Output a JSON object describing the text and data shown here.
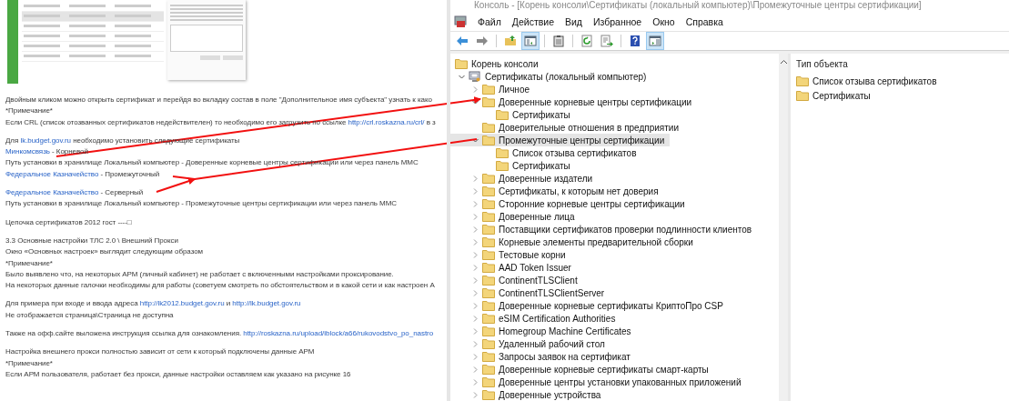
{
  "document": {
    "paragraphs": [
      {
        "lines": [
          [
            {
              "kind": "plain",
              "text": "Двойным кликом можно открыть сертификат и перейдя во вкладку состав в поле \"Дополнительное имя субъекта\" узнать к како"
            }
          ],
          [
            {
              "kind": "plain",
              "text": "*Примечание*"
            }
          ],
          [
            {
              "kind": "plain",
              "text": "Если CRL (список отозванных сертификатов недействителен) то необходимо его загрузить по ссылке "
            },
            {
              "kind": "link",
              "text": "http://crl.roskazna.ru/crl/"
            },
            {
              "kind": "plain",
              "text": " в з"
            }
          ]
        ]
      },
      {
        "lines": [
          [
            {
              "kind": "plain",
              "text": "Для "
            },
            {
              "kind": "link",
              "text": "lk.budget.gov.ru"
            },
            {
              "kind": "plain",
              "text": " необходимо установить следующие сертификаты"
            }
          ],
          [
            {
              "kind": "link",
              "text": "Минкомсвязь"
            },
            {
              "kind": "plain",
              "text": " - Корневой"
            }
          ],
          [
            {
              "kind": "plain",
              "text": "Путь установки в хранилище Локальный компьютер - Доверенные корневые центры сертификации или через панель MMC"
            }
          ],
          [
            {
              "kind": "link",
              "text": "Федеральное Казначейство"
            },
            {
              "kind": "plain",
              "text": " - Промежуточный"
            }
          ]
        ]
      },
      {
        "lines": [
          [
            {
              "kind": "link",
              "text": "Федеральное Казначейство"
            },
            {
              "kind": "plain",
              "text": " - Серверный"
            }
          ],
          [
            {
              "kind": "plain",
              "text": "Путь установки в хранилище Локальный компьютер - Промежуточные центры сертификации или через панель MMC"
            }
          ]
        ]
      },
      {
        "lines": [
          [
            {
              "kind": "plain",
              "text": "Цепочка сертификатов 2012 гост ----□"
            }
          ]
        ]
      },
      {
        "lines": [
          [
            {
              "kind": "plain",
              "text": "3.3 Основные настройки ТЛС 2.0 \\ Внешний Прокси"
            }
          ],
          [
            {
              "kind": "plain",
              "text": "Окно «Основных настроек» выглядит следующим образом"
            }
          ],
          [
            {
              "kind": "plain",
              "text": "*Примечание*"
            }
          ],
          [
            {
              "kind": "plain",
              "text": "Было выявлено что, на некоторых АРМ (личный кабинет) не работает с включенными настройками проксирование."
            }
          ],
          [
            {
              "kind": "plain",
              "text": "На некоторых данные галочки необходимы для работы (советуем смотреть по обстоятельством и в какой сети и как настроен А"
            }
          ]
        ]
      },
      {
        "lines": [
          [
            {
              "kind": "plain",
              "text": "Для примера при входе и ввода адреса "
            },
            {
              "kind": "link",
              "text": "http://lk2012.budget.gov.ru"
            },
            {
              "kind": "plain",
              "text": " и "
            },
            {
              "kind": "link",
              "text": "http://lk.budget.gov.ru"
            }
          ],
          [
            {
              "kind": "plain",
              "text": "Не отображается страница\\Страница не доступна"
            }
          ]
        ]
      },
      {
        "lines": [
          [
            {
              "kind": "plain",
              "text": "Также на офф.сайте выложена инструкция ссылка для ознакомления. "
            },
            {
              "kind": "link",
              "text": "http://roskazna.ru/upload/iblock/a66/rukovodstvo_po_nastro"
            }
          ]
        ]
      },
      {
        "lines": [
          [
            {
              "kind": "plain",
              "text": "Настройка внешнего прокси полностью зависит от сети к который подключены данные АРМ"
            }
          ],
          [
            {
              "kind": "plain",
              "text": "*Примечание*"
            }
          ],
          [
            {
              "kind": "plain",
              "text": "Если АРМ пользователя, работает без прокси, данные настройки оставляем как указано на рисунке 16"
            }
          ]
        ]
      }
    ]
  },
  "console": {
    "title": "Консоль - [Корень консоли\\Сертификаты (локальный компьютер)\\Промежуточные центры сертификации]",
    "menu": [
      "Файл",
      "Действие",
      "Вид",
      "Избранное",
      "Окно",
      "Справка"
    ],
    "toolbar": [
      {
        "kind": "back",
        "pressed": false
      },
      {
        "kind": "forward",
        "pressed": false
      },
      {
        "kind": "separator"
      },
      {
        "kind": "up",
        "pressed": false
      },
      {
        "kind": "tree",
        "pressed": true
      },
      {
        "kind": "separator"
      },
      {
        "kind": "clipboard",
        "pressed": false
      },
      {
        "kind": "separator"
      },
      {
        "kind": "refresh",
        "pressed": false
      },
      {
        "kind": "export",
        "pressed": false
      },
      {
        "kind": "separator"
      },
      {
        "kind": "help",
        "pressed": false
      },
      {
        "kind": "actions",
        "pressed": true
      }
    ],
    "tree": [
      {
        "label": "Корень консоли",
        "kind": "folder",
        "selected": false,
        "children": [
          {
            "label": "Сертификаты (локальный компьютер)",
            "kind": "store",
            "selected": false,
            "expanded": true,
            "children": [
              {
                "label": "Личное",
                "kind": "folder",
                "selected": false,
                "expanded": false
              },
              {
                "label": "Доверенные корневые центры сертификации",
                "kind": "folder",
                "selected": false,
                "expanded": true,
                "children": [
                  {
                    "label": "Сертификаты",
                    "kind": "folder",
                    "selected": false
                  }
                ]
              },
              {
                "label": "Доверительные отношения в предприятии",
                "kind": "folder",
                "selected": false
              },
              {
                "label": "Промежуточные центры сертификации",
                "kind": "folder",
                "selected": true,
                "expanded": true,
                "children": [
                  {
                    "label": "Список отзыва сертификатов",
                    "kind": "folder",
                    "selected": false
                  },
                  {
                    "label": "Сертификаты",
                    "kind": "folder",
                    "selected": false
                  }
                ]
              },
              {
                "label": "Доверенные издатели",
                "kind": "folder",
                "selected": false,
                "expanded": false
              },
              {
                "label": "Сертификаты, к которым нет доверия",
                "kind": "folder",
                "selected": false,
                "expanded": false
              },
              {
                "label": "Сторонние корневые центры сертификации",
                "kind": "folder",
                "selected": false,
                "expanded": false
              },
              {
                "label": "Доверенные лица",
                "kind": "folder",
                "selected": false,
                "expanded": false
              },
              {
                "label": "Поставщики сертификатов проверки подлинности клиентов",
                "kind": "folder",
                "selected": false,
                "expanded": false
              },
              {
                "label": "Корневые элементы предварительной сборки",
                "kind": "folder",
                "selected": false,
                "expanded": false
              },
              {
                "label": "Тестовые корни",
                "kind": "folder",
                "selected": false,
                "expanded": false
              },
              {
                "label": "AAD Token Issuer",
                "kind": "folder",
                "selected": false,
                "expanded": false
              },
              {
                "label": "ContinentTLSClient",
                "kind": "folder",
                "selected": false,
                "expanded": false
              },
              {
                "label": "ContinentTLSClientServer",
                "kind": "folder",
                "selected": false,
                "expanded": false
              },
              {
                "label": "Доверенные корневые сертификаты КриптоПро CSP",
                "kind": "folder",
                "selected": false,
                "expanded": false
              },
              {
                "label": "eSIM Certification Authorities",
                "kind": "folder",
                "selected": false,
                "expanded": false
              },
              {
                "label": "Homegroup Machine Certificates",
                "kind": "folder",
                "selected": false,
                "expanded": false
              },
              {
                "label": "Удаленный рабочий стол",
                "kind": "folder",
                "selected": false,
                "expanded": false
              },
              {
                "label": "Запросы заявок на сертификат",
                "kind": "folder",
                "selected": false,
                "expanded": false
              },
              {
                "label": "Доверенные корневые сертификаты смарт-карты",
                "kind": "folder",
                "selected": false,
                "expanded": false
              },
              {
                "label": "Доверенные центры установки упакованных приложений",
                "kind": "folder",
                "selected": false,
                "expanded": false
              },
              {
                "label": "Доверенные устройства",
                "kind": "folder",
                "selected": false,
                "expanded": false
              }
            ]
          }
        ]
      }
    ],
    "list": {
      "header": "Тип объекта",
      "items": [
        "Список отзыва сертификатов",
        "Сертификаты"
      ]
    }
  }
}
